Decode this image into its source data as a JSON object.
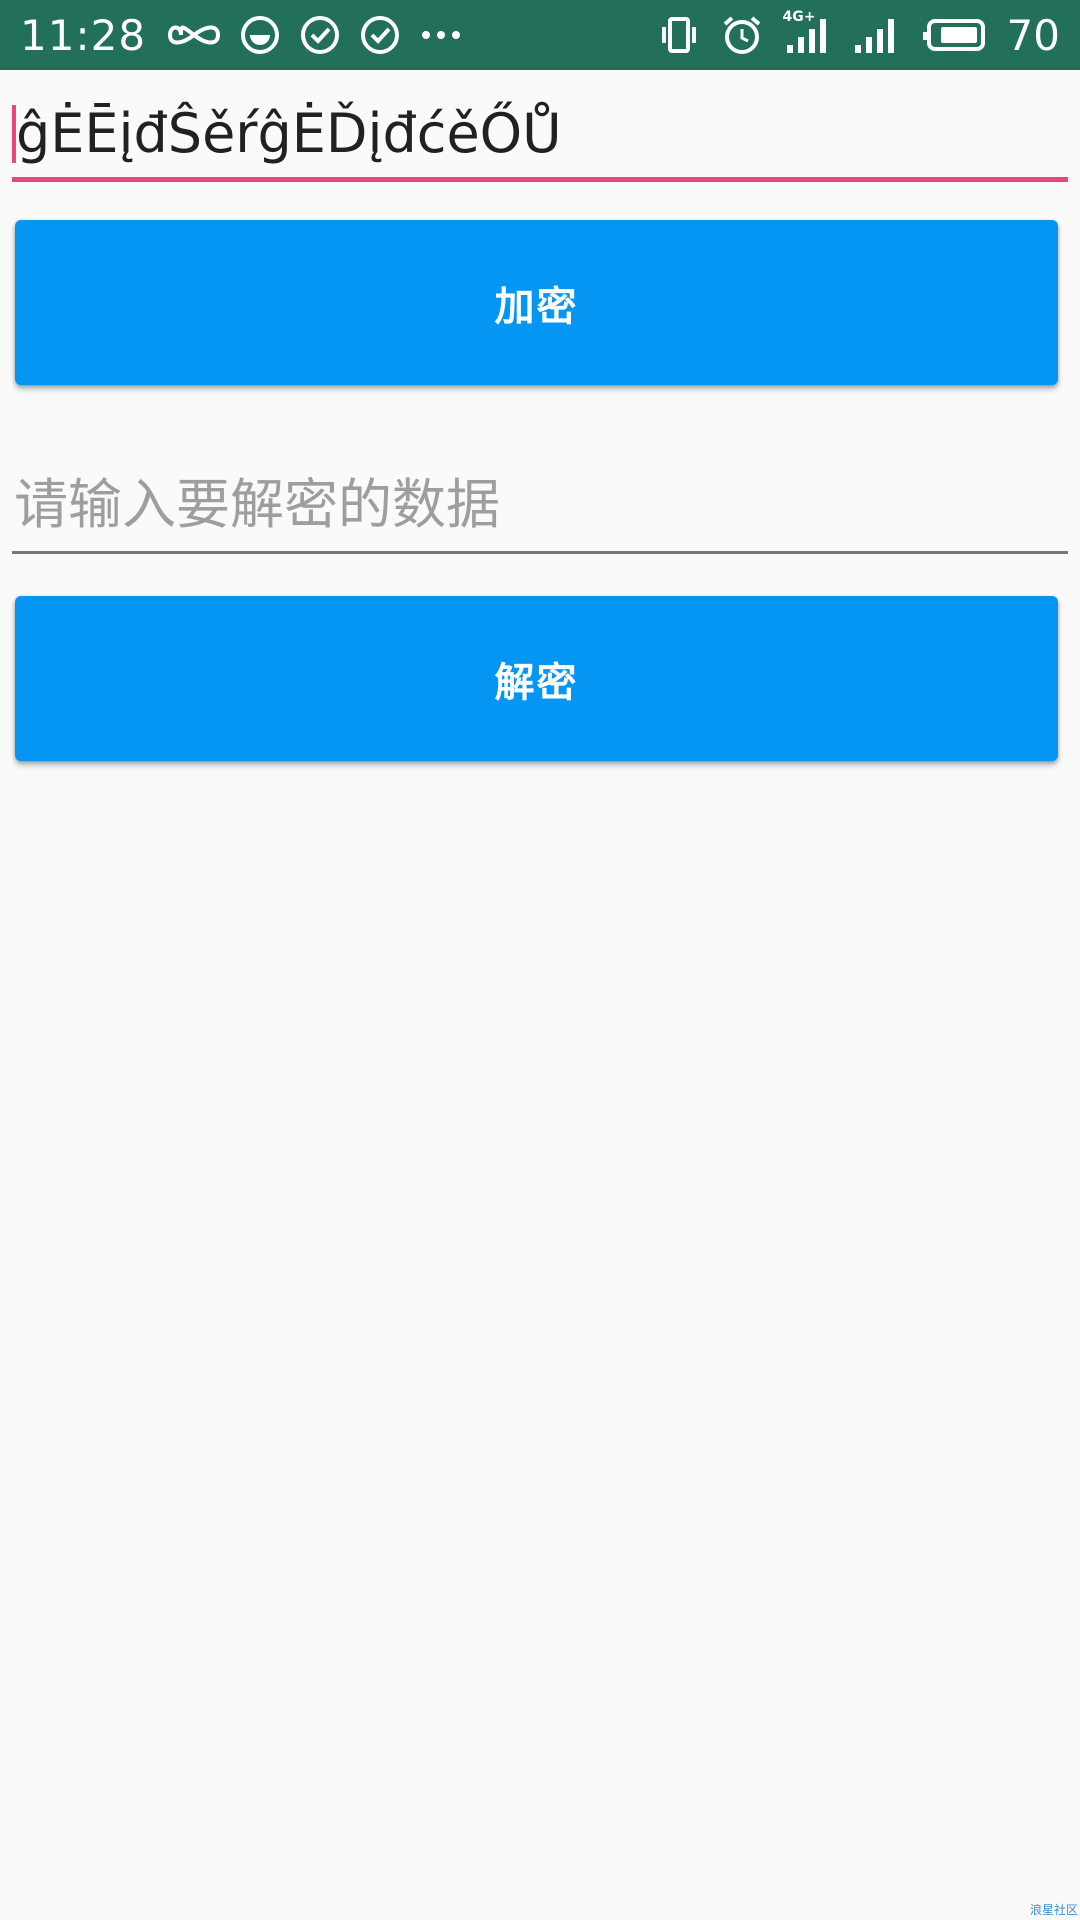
{
  "status_bar": {
    "time": "11:28",
    "network_type": "4G+",
    "battery_level": "70",
    "icons_left": [
      "infinity-icon",
      "face-icon",
      "check-circle-icon",
      "check-circle-icon",
      "more-dots-icon"
    ],
    "icons_right": [
      "vibrate-icon",
      "alarm-icon",
      "signal-icon",
      "signal-icon",
      "battery-icon"
    ],
    "background_color": "#22705a"
  },
  "encrypt_section": {
    "input_value": "ĝĖĒįđŜěŕĝĖĎįđćěŐŮ",
    "underline_color": "#e8477b",
    "button_label": "加密"
  },
  "decrypt_section": {
    "input_value": "",
    "placeholder": "请输入要解密的数据",
    "button_label": "解密"
  },
  "theme": {
    "button_color": "#0596f3",
    "background": "#fafafa"
  },
  "watermark": "浪星社区"
}
